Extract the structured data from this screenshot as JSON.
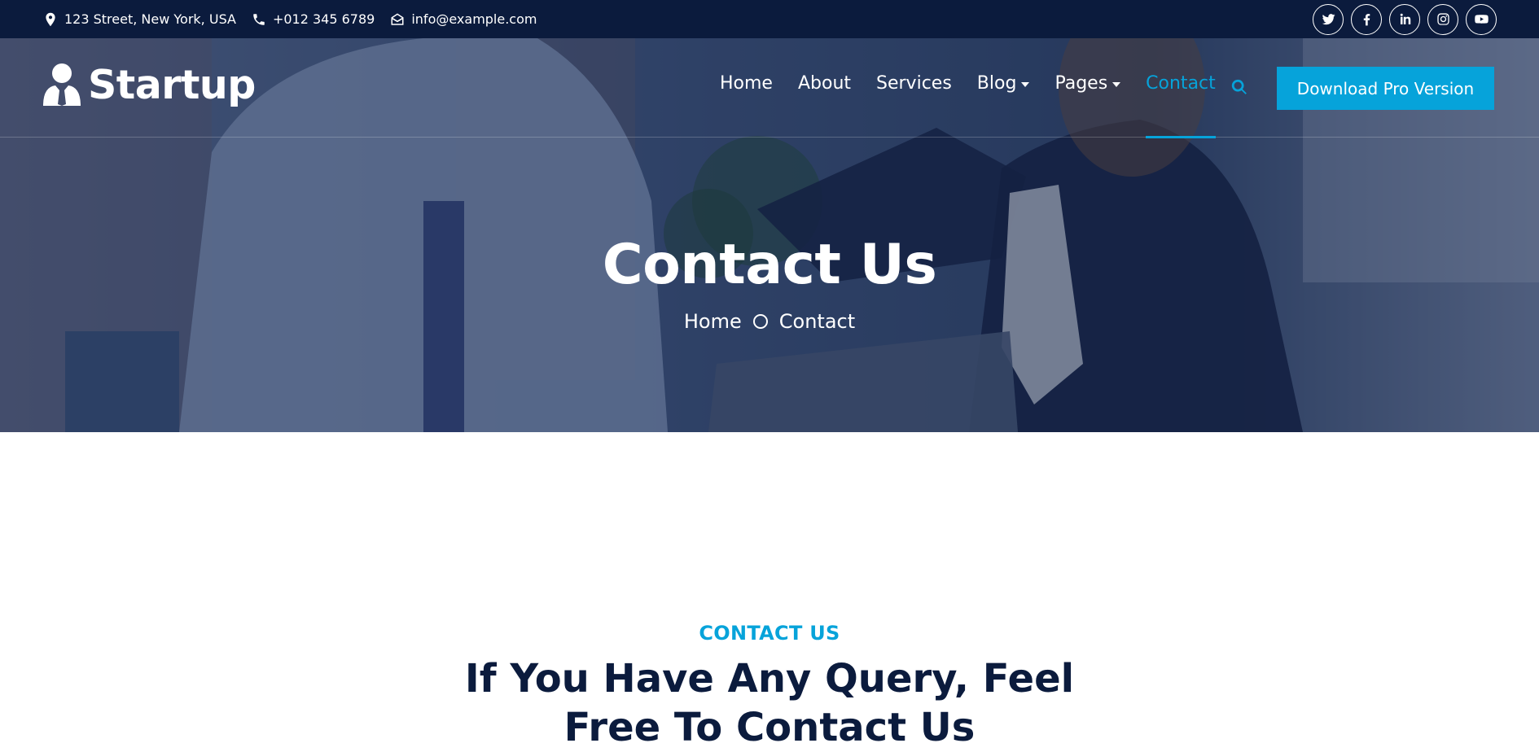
{
  "topbar": {
    "address": "123 Street, New York, USA",
    "phone": "+012 345 6789",
    "email": "info@example.com",
    "social": [
      "twitter-icon",
      "facebook-icon",
      "linkedin-icon",
      "instagram-icon",
      "youtube-icon"
    ]
  },
  "navbar": {
    "brand": "Startup",
    "items": [
      {
        "label": "Home"
      },
      {
        "label": "About"
      },
      {
        "label": "Services"
      },
      {
        "label": "Blog",
        "dropdown": true
      },
      {
        "label": "Pages",
        "dropdown": true
      },
      {
        "label": "Contact",
        "active": true
      }
    ],
    "cta": "Download Pro Version"
  },
  "hero": {
    "title": "Contact Us",
    "breadcrumb": [
      "Home",
      "Contact"
    ]
  },
  "section": {
    "label": "CONTACT US",
    "heading": "If You Have Any Query, Feel Free To Contact Us"
  },
  "colors": {
    "primary": "#06a3da",
    "dark": "#0b1b3d"
  }
}
